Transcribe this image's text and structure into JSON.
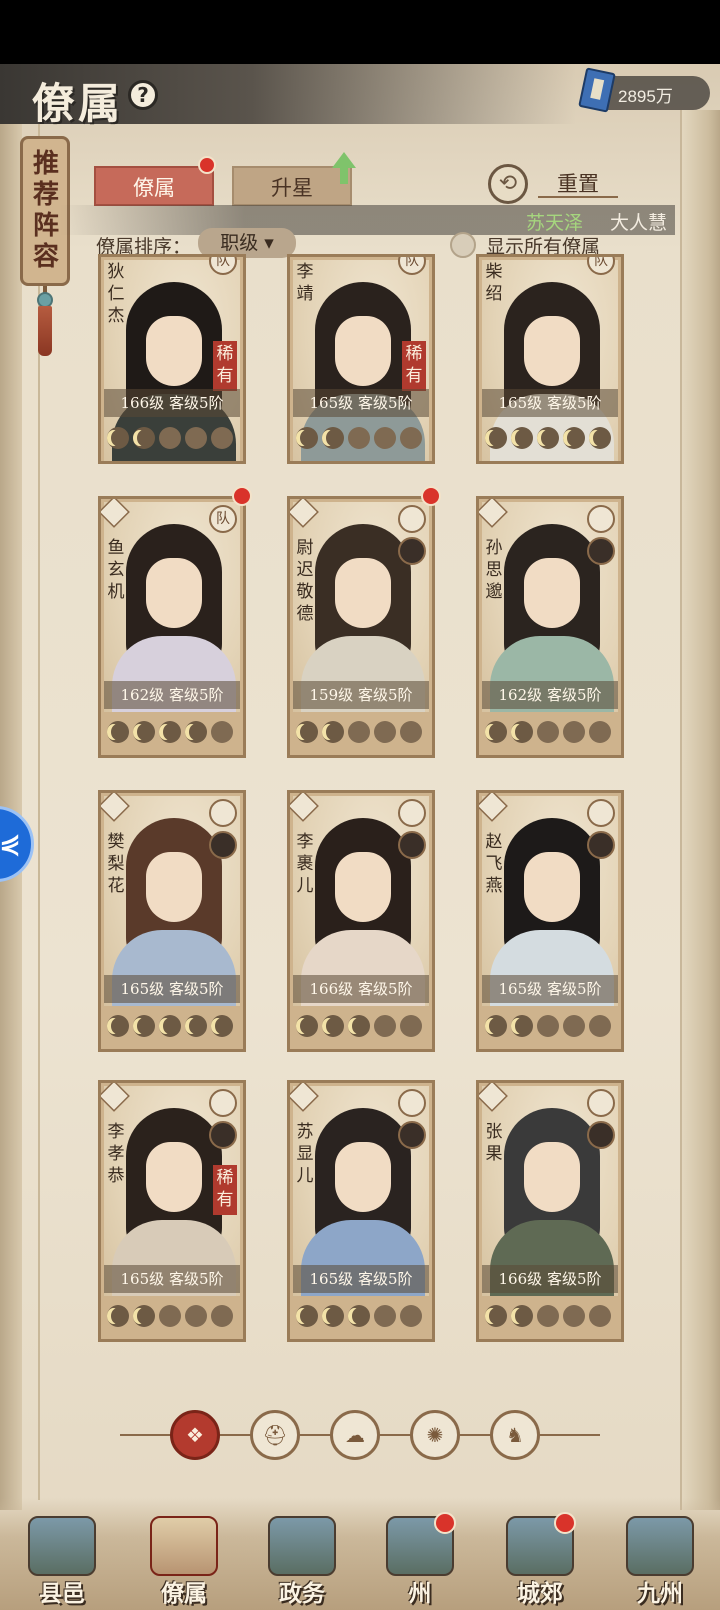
{
  "header": {
    "title": "僚属",
    "help_symbol": "?",
    "currency_value": "2895万",
    "side_scroll_label": "推荐阵容"
  },
  "tabs": [
    {
      "label": "僚属",
      "active": true
    },
    {
      "label": "升星",
      "active": false
    }
  ],
  "reset_label": "重置",
  "ticker": {
    "name": "苏天泽",
    "text": "大人慧"
  },
  "sort": {
    "label": "僚属排序：",
    "value": "职级 ▾"
  },
  "show_all_label": "显示所有僚属",
  "cards": [
    {
      "name": "狄仁杰",
      "level": "166级",
      "rank": "客级5阶",
      "stars": 2,
      "rare": "稀有",
      "badge": "队",
      "dot": false
    },
    {
      "name": "李靖",
      "level": "165级",
      "rank": "客级5阶",
      "stars": 2,
      "rare": "稀有",
      "badge": "队",
      "dot": false
    },
    {
      "name": "柴绍",
      "level": "165级",
      "rank": "客级5阶",
      "stars": 5,
      "rare": "",
      "badge": "队",
      "dot": false
    },
    {
      "name": "鱼玄机",
      "level": "162级",
      "rank": "客级5阶",
      "stars": 4,
      "rare": "",
      "badge": "队",
      "dot": true
    },
    {
      "name": "尉迟敬德",
      "level": "159级",
      "rank": "客级5阶",
      "stars": 2,
      "rare": "",
      "badge": "",
      "dot": true
    },
    {
      "name": "孙思邈",
      "level": "162级",
      "rank": "客级5阶",
      "stars": 2,
      "rare": "",
      "badge": "",
      "dot": false
    },
    {
      "name": "樊梨花",
      "level": "165级",
      "rank": "客级5阶",
      "stars": 5,
      "rare": "",
      "badge": "",
      "dot": false
    },
    {
      "name": "李裹儿",
      "level": "166级",
      "rank": "客级5阶",
      "stars": 3,
      "rare": "",
      "badge": "",
      "dot": false
    },
    {
      "name": "赵飞燕",
      "level": "165级",
      "rank": "客级5阶",
      "stars": 2,
      "rare": "",
      "badge": "",
      "dot": false
    },
    {
      "name": "李孝恭",
      "level": "165级",
      "rank": "客级5阶",
      "stars": 2,
      "rare": "稀有",
      "badge": "",
      "dot": false
    },
    {
      "name": "苏显儿",
      "level": "165级",
      "rank": "客级5阶",
      "stars": 3,
      "rare": "",
      "badge": "",
      "dot": false
    },
    {
      "name": "张果",
      "level": "166级",
      "rank": "客级5阶",
      "stars": 2,
      "rare": "",
      "badge": "",
      "dot": false
    }
  ],
  "filters": [
    {
      "icon": "all-icon",
      "symbol": "❖",
      "active": true
    },
    {
      "icon": "helmet-icon",
      "symbol": "⛑",
      "active": false
    },
    {
      "icon": "creature-icon",
      "symbol": "☁",
      "active": false
    },
    {
      "icon": "fan-icon",
      "symbol": "✺",
      "active": false
    },
    {
      "icon": "beast-icon",
      "symbol": "♞",
      "active": false
    }
  ],
  "bottom_nav": [
    {
      "label": "县邑",
      "active": false,
      "dot": false
    },
    {
      "label": "僚属",
      "active": true,
      "dot": false
    },
    {
      "label": "政务",
      "active": false,
      "dot": false
    },
    {
      "label": "州",
      "active": false,
      "dot": true
    },
    {
      "label": "城郊",
      "active": false,
      "dot": true
    },
    {
      "label": "九州",
      "active": false,
      "dot": false
    }
  ],
  "floating_button_symbol": "⋞"
}
